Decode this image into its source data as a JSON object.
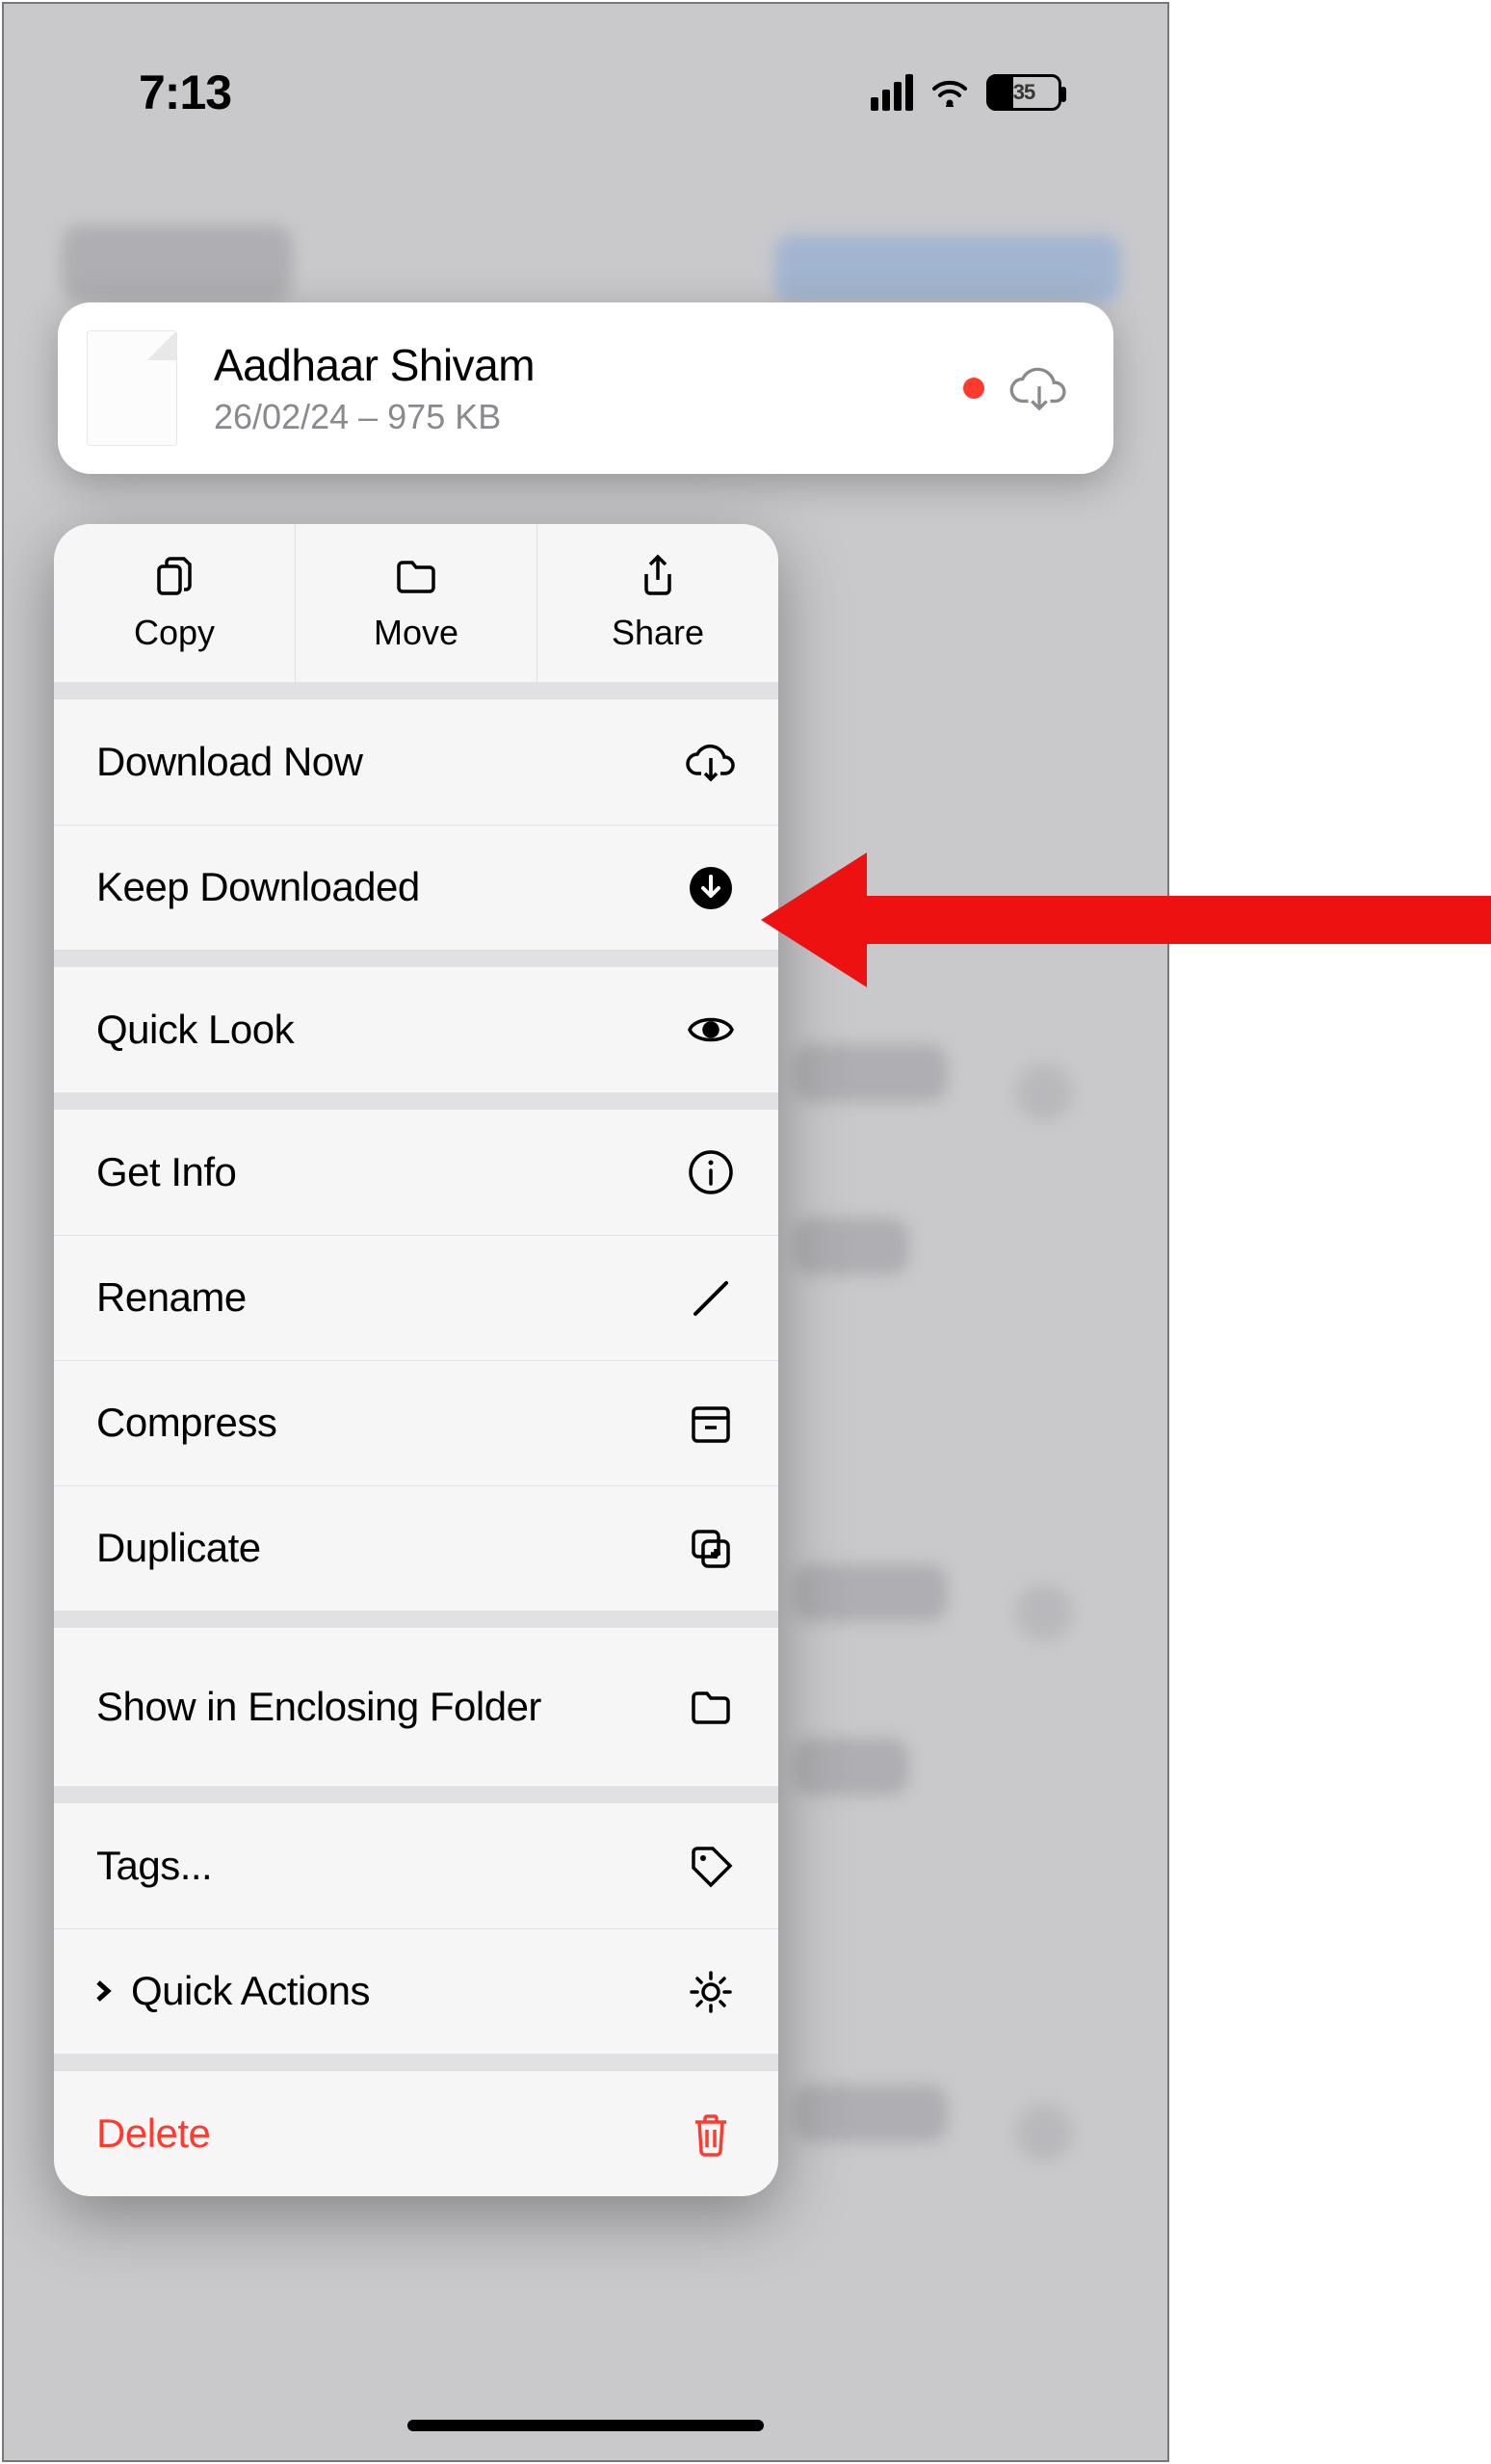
{
  "status": {
    "time": "7:13",
    "battery_pct": "35"
  },
  "file": {
    "name": "Aadhaar Shivam",
    "meta": "26/02/24 – 975 KB"
  },
  "top_actions": {
    "copy": "Copy",
    "move": "Move",
    "share": "Share"
  },
  "menu": {
    "download_now": "Download Now",
    "keep_downloaded": "Keep Downloaded",
    "quick_look": "Quick Look",
    "get_info": "Get Info",
    "rename": "Rename",
    "compress": "Compress",
    "duplicate": "Duplicate",
    "show_enclosing": "Show in Enclosing Folder",
    "tags": "Tags...",
    "quick_actions": "Quick Actions",
    "delete": "Delete"
  }
}
